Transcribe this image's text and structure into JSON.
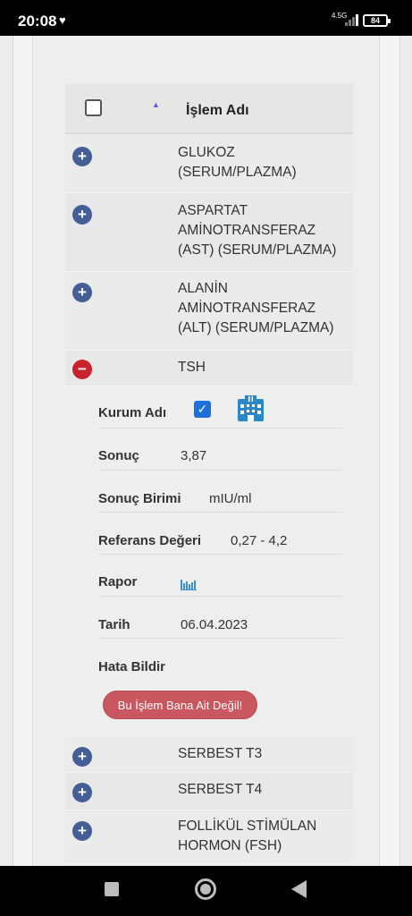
{
  "status_bar": {
    "time": "20:08",
    "network": "4.5G",
    "battery": "84"
  },
  "table": {
    "header": {
      "title": "İşlem Adı"
    },
    "rows_top": [
      {
        "name": "GLUKOZ\n(SERUM/PLAZMA)"
      },
      {
        "name": "ASPARTAT\nAMİNOTRANSFERAZ\n(AST) (SERUM/PLAZMA)"
      },
      {
        "name": "ALANİN\nAMİNOTRANSFERAZ\n(ALT) (SERUM/PLAZMA)"
      }
    ],
    "expanded_row": {
      "name": "TSH",
      "details": {
        "kurum_label": "Kurum Adı",
        "sonuc_label": "Sonuç",
        "sonuc_value": "3,87",
        "birim_label": "Sonuç Birimi",
        "birim_value": "mIU/ml",
        "referans_label": "Referans Değeri",
        "referans_value": "0,27 - 4,2",
        "rapor_label": "Rapor",
        "tarih_label": "Tarih",
        "tarih_value": "06.04.2023",
        "hata_label": "Hata Bildir",
        "hata_button": "Bu İşlem Bana Ait Değil!"
      }
    },
    "rows_bottom": [
      {
        "name": "SERBEST T3"
      },
      {
        "name": "SERBEST T4"
      },
      {
        "name": "FOLLİKÜL STİMÜLAN\nHORMON (FSH)"
      }
    ]
  }
}
